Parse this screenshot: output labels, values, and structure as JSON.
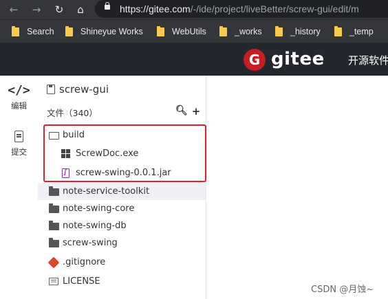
{
  "browser": {
    "url_host": "https://gitee.com",
    "url_path": "/-/ide/project/liveBetter/screw-gui/edit/m"
  },
  "bookmarks": [
    {
      "label": "Search"
    },
    {
      "label": "Shineyue Works"
    },
    {
      "label": "WebUtils"
    },
    {
      "label": "_works"
    },
    {
      "label": "_history"
    },
    {
      "label": "_temp"
    }
  ],
  "header": {
    "logo_letter": "G",
    "brand": "gitee",
    "nav_text": "开源软件"
  },
  "rail": {
    "edit_label": "编辑",
    "commit_label": "提交"
  },
  "tree": {
    "repo_name": "screw-gui",
    "file_count": "文件（340）",
    "items": [
      {
        "label": "build",
        "type": "folder-open"
      },
      {
        "label": "ScrewDoc.exe",
        "type": "exe"
      },
      {
        "label": "screw-swing-0.0.1.jar",
        "type": "jar"
      },
      {
        "label": "note-service-toolkit",
        "type": "folder"
      },
      {
        "label": "note-swing-core",
        "type": "folder"
      },
      {
        "label": "note-swing-db",
        "type": "folder"
      },
      {
        "label": "screw-swing",
        "type": "folder"
      },
      {
        "label": ".gitignore",
        "type": "git"
      },
      {
        "label": "LICENSE",
        "type": "license"
      }
    ]
  },
  "watermark": "CSDN @月蚀~"
}
